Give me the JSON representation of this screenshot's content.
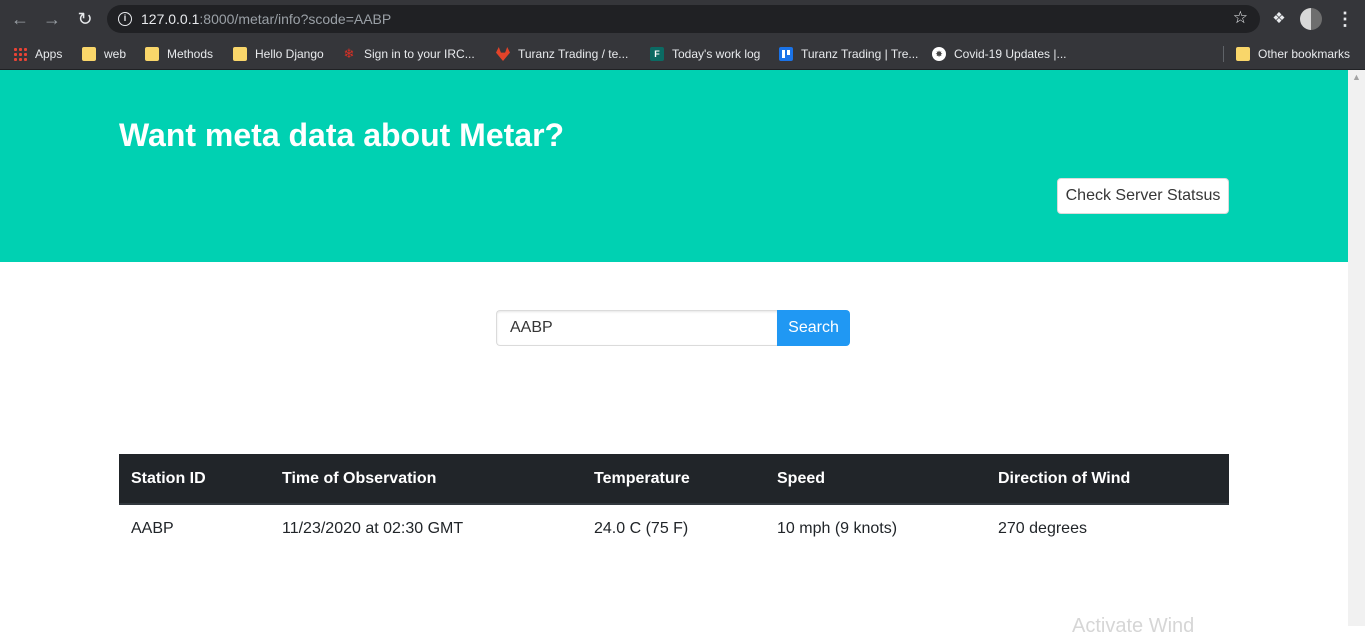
{
  "browser": {
    "url_host": "127.0.0.1",
    "url_rest": ":8000/metar/info?scode=AABP",
    "bookmarks": [
      {
        "label": "Apps",
        "icon": "apps-grid-icon"
      },
      {
        "label": "web",
        "icon": "folder-icon"
      },
      {
        "label": "Methods",
        "icon": "folder-icon"
      },
      {
        "label": "Hello Django",
        "icon": "folder-icon"
      },
      {
        "label": "Sign in to your IRC...",
        "icon": "maple-leaf-icon"
      },
      {
        "label": "Turanz Trading / te...",
        "icon": "gitlab-icon"
      },
      {
        "label": "Today's work log",
        "icon": "forms-icon"
      },
      {
        "label": "Turanz Trading | Tre...",
        "icon": "trello-icon"
      },
      {
        "label": "Covid-19 Updates |...",
        "icon": "covid-icon"
      },
      {
        "label": "Other bookmarks",
        "icon": "folder-icon"
      }
    ]
  },
  "hero": {
    "title": "Want meta data about Metar?",
    "status_button": "Check Server Statsus",
    "background_color": "#00d1b2"
  },
  "search": {
    "value": "AABP",
    "button_label": "Search",
    "button_color": "#2098f3"
  },
  "table": {
    "headers": [
      "Station ID",
      "Time of Observation",
      "Temperature",
      "Speed",
      "Direction of Wind"
    ],
    "rows": [
      [
        "AABP",
        "11/23/2020 at 02:30 GMT",
        "24.0 C (75 F)",
        "10 mph (9 knots)",
        "270 degrees"
      ]
    ]
  },
  "watermark": "Activate Wind"
}
